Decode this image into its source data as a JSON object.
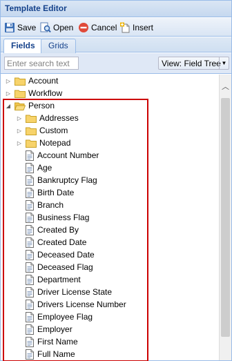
{
  "window": {
    "title": "Template Editor"
  },
  "toolbar": {
    "save_label": "Save",
    "open_label": "Open",
    "cancel_label": "Cancel",
    "insert_label": "Insert"
  },
  "tabs": [
    {
      "label": "Fields",
      "active": true
    },
    {
      "label": "Grids",
      "active": false
    }
  ],
  "search": {
    "placeholder": "Enter search text",
    "value": ""
  },
  "view_select": {
    "value": "View: Field Tree"
  },
  "tree": {
    "top_folders": [
      {
        "label": "Account",
        "expanded": false
      },
      {
        "label": "Workflow",
        "expanded": false
      }
    ],
    "person": {
      "label": "Person",
      "expanded": true,
      "sub_folders": [
        "Addresses",
        "Custom",
        "Notepad"
      ],
      "fields": [
        "Account Number",
        "Age",
        "Bankruptcy Flag",
        "Birth Date",
        "Branch",
        "Business Flag",
        "Created By",
        "Created Date",
        "Deceased Date",
        "Deceased Flag",
        "Department",
        "Driver License State",
        "Drivers License Number",
        "Employee Flag",
        "Employer",
        "First Name",
        "Full Name"
      ]
    }
  },
  "colors": {
    "accent": "#15428b",
    "highlight": "#cc0000",
    "folder": "#f5c542"
  }
}
